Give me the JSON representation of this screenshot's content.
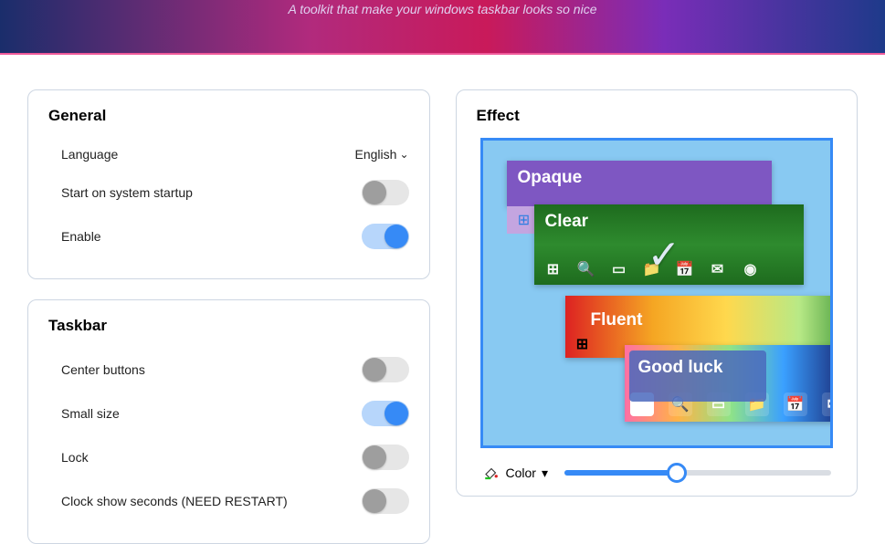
{
  "banner": {
    "tagline": "A toolkit that make your windows taskbar looks so nice"
  },
  "general": {
    "title": "General",
    "language_label": "Language",
    "language_value": "English",
    "startup_label": "Start on system startup",
    "startup_on": false,
    "enable_label": "Enable",
    "enable_on": true
  },
  "taskbar": {
    "title": "Taskbar",
    "center_label": "Center buttons",
    "center_on": false,
    "small_label": "Small size",
    "small_on": true,
    "lock_label": "Lock",
    "lock_on": false,
    "clockseconds_label": "Clock show seconds (NEED RESTART)",
    "clockseconds_on": false
  },
  "effect": {
    "title": "Effect",
    "options": {
      "opaque": "Opaque",
      "clear": "Clear",
      "fluent": "Fluent",
      "goodluck": "Good luck"
    },
    "selected": "clear",
    "color_label": "Color",
    "slider_value": 42
  }
}
